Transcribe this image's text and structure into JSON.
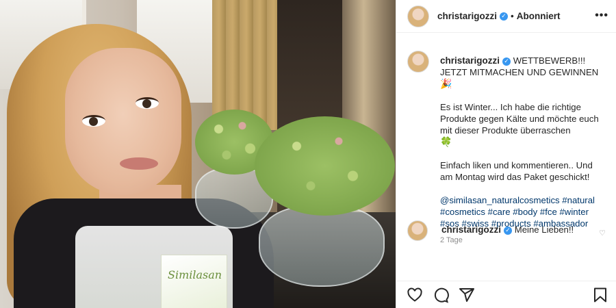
{
  "post": {
    "username": "christarigozzi",
    "dot": "•",
    "follow_status": "Abonniert",
    "more_label": "•••"
  },
  "caption": {
    "username": "christarigozzi",
    "line1": "WETTBEWERB!!! JETZT MITMACHEN UND GEWINNEN",
    "emoji1": "🎉",
    "para2": "Es ist Winter... Ich habe die richtige Produkte gegen Kälte und möchte euch mit dieser Produkte überraschen",
    "emoji2": "🍀",
    "para3": "Einfach liken und kommentieren.. Und am Montag wird das Paket geschickt!",
    "hashtags": "@similasan_naturalcosmetics #natural #cosmetics #care #body #fce #winter #sos #swiss #products #ambassador",
    "time_ago": "2 Tage"
  },
  "comment": {
    "username": "christarigozzi",
    "text": "Meine Lieben!!",
    "heart": "♡"
  },
  "photo": {
    "card_text": "Similasan"
  },
  "icons": [
    "heart-icon",
    "comment-icon",
    "share-icon",
    "bookmark-icon",
    "verified-icon",
    "more-icon"
  ]
}
